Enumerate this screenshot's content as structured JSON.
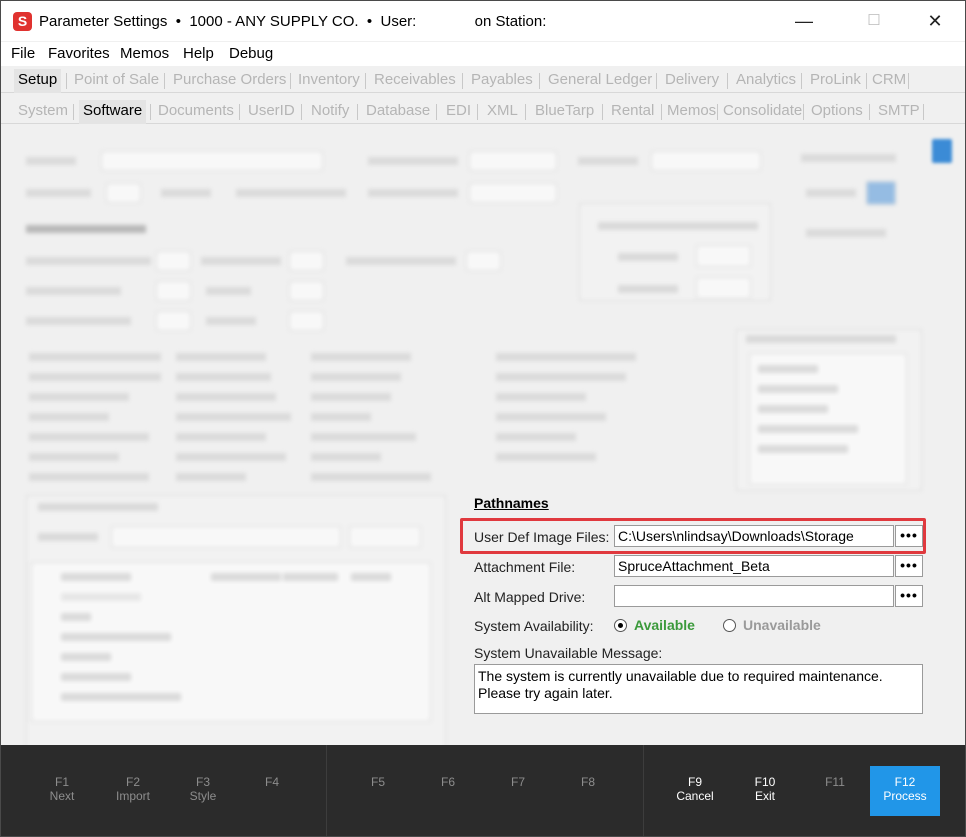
{
  "window": {
    "title": "Parameter Settings  •  1000 - ANY SUPPLY CO.  •  User:              on Station:",
    "app_icon_letter": "S"
  },
  "menu": [
    "File",
    "Favorites",
    "Memos",
    "Help",
    "Debug"
  ],
  "main_tabs": [
    "Setup",
    "Point of Sale",
    "Purchase Orders",
    "Inventory",
    "Receivables",
    "Payables",
    "General Ledger",
    "Delivery",
    "Analytics",
    "ProLink",
    "CRM"
  ],
  "sub_tabs": [
    "System",
    "Software",
    "Documents",
    "UserID",
    "Notify",
    "Database",
    "EDI",
    "XML",
    "BlueTarp",
    "Rental",
    "Memos",
    "Consolidate",
    "Options",
    "SMTP"
  ],
  "pathnames": {
    "section_title": "Pathnames",
    "user_def_image_label": "User Def Image Files:",
    "user_def_image_value": "C:\\Users\\nlindsay\\Downloads\\Storage",
    "attachment_label": "Attachment File:",
    "attachment_value": "SpruceAttachment_Beta",
    "alt_drive_label": "Alt Mapped Drive:",
    "alt_drive_value": "",
    "browse_glyph": "•••",
    "availability_label": "System Availability:",
    "available_label": "Available",
    "unavailable_label": "Unavailable",
    "unavailable_msg_label": "System Unavailable Message:",
    "unavailable_msg_value": "The system is currently unavailable due to required maintenance.\nPlease try again later."
  },
  "fkeys": [
    {
      "key": "F1",
      "label": "Next"
    },
    {
      "key": "F2",
      "label": "Import"
    },
    {
      "key": "F3",
      "label": "Style"
    },
    {
      "key": "F4",
      "label": ""
    },
    {
      "key": "F5",
      "label": ""
    },
    {
      "key": "F6",
      "label": ""
    },
    {
      "key": "F7",
      "label": ""
    },
    {
      "key": "F8",
      "label": ""
    },
    {
      "key": "F9",
      "label": "Cancel"
    },
    {
      "key": "F10",
      "label": "Exit"
    },
    {
      "key": "F11",
      "label": ""
    },
    {
      "key": "F12",
      "label": "Process"
    }
  ],
  "colors": {
    "accent": "#2196e8",
    "highlight": "#e0393e",
    "available": "#3b9a3b"
  }
}
